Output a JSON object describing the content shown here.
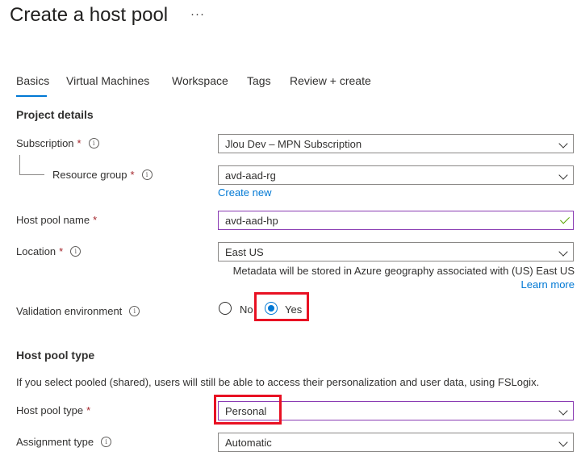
{
  "page": {
    "title": "Create a host pool",
    "more_label": "···"
  },
  "tabs": [
    {
      "label": "Basics",
      "active": true
    },
    {
      "label": "Virtual Machines",
      "active": false
    },
    {
      "label": "Workspace",
      "active": false
    },
    {
      "label": "Tags",
      "active": false
    },
    {
      "label": "Review + create",
      "active": false
    }
  ],
  "project_details": {
    "heading": "Project details",
    "subscription": {
      "label": "Subscription",
      "required": "*",
      "value": "Jlou Dev – MPN Subscription"
    },
    "resource_group": {
      "label": "Resource group",
      "required": "*",
      "value": "avd-aad-rg",
      "create_new": "Create new"
    },
    "host_pool_name": {
      "label": "Host pool name",
      "required": "*",
      "value": "avd-aad-hp"
    },
    "location": {
      "label": "Location",
      "required": "*",
      "value": "East US",
      "note": "Metadata will be stored in Azure geography associated with (US) East US",
      "learn_more": "Learn more"
    },
    "validation_environment": {
      "label": "Validation environment",
      "options": [
        "No",
        "Yes"
      ],
      "selected": "Yes"
    }
  },
  "host_pool_type_section": {
    "heading": "Host pool type",
    "description": "If you select pooled (shared), users will still be able to access their personalization and user data, using FSLogix.",
    "host_pool_type": {
      "label": "Host pool type",
      "required": "*",
      "value": "Personal"
    },
    "assignment_type": {
      "label": "Assignment type",
      "value": "Automatic"
    }
  },
  "icons": {
    "info": "i"
  },
  "colors": {
    "accent": "#0078d4",
    "required": "#a4262c",
    "highlight": "#e81123",
    "valid": "#57a300",
    "focus_border": "#8a3bb3"
  }
}
